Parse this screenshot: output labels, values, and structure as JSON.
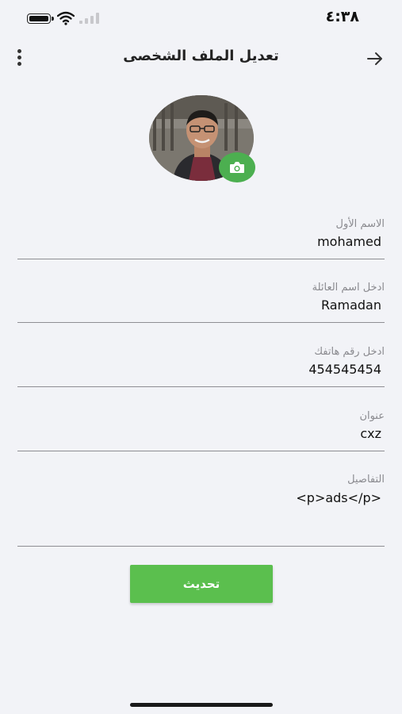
{
  "status_bar": {
    "time": "٤:٣٨",
    "icons": [
      "battery-icon",
      "wifi-icon",
      "signal-icon"
    ]
  },
  "header": {
    "title": "تعديل الملف الشخصى",
    "back_icon": "arrow-right-icon",
    "menu_icon": "vertical-dots-icon"
  },
  "avatar": {
    "camera_icon": "camera-icon"
  },
  "form": {
    "first_name": {
      "label": "الاسم الأول",
      "value": "mohamed"
    },
    "last_name": {
      "label": "ادخل اسم العائلة",
      "value": "Ramadan"
    },
    "phone": {
      "label": "ادخل رقم هاتفك",
      "value": "454545454"
    },
    "address": {
      "label": "عنوان",
      "value": "cxz"
    },
    "details": {
      "label": "التفاصيل",
      "value": "<p>ads</p>"
    }
  },
  "submit": {
    "label": "تحديث"
  },
  "colors": {
    "accent": "#5bbf4e",
    "background": "#f2f3f7",
    "underline": "#8e8e93"
  }
}
